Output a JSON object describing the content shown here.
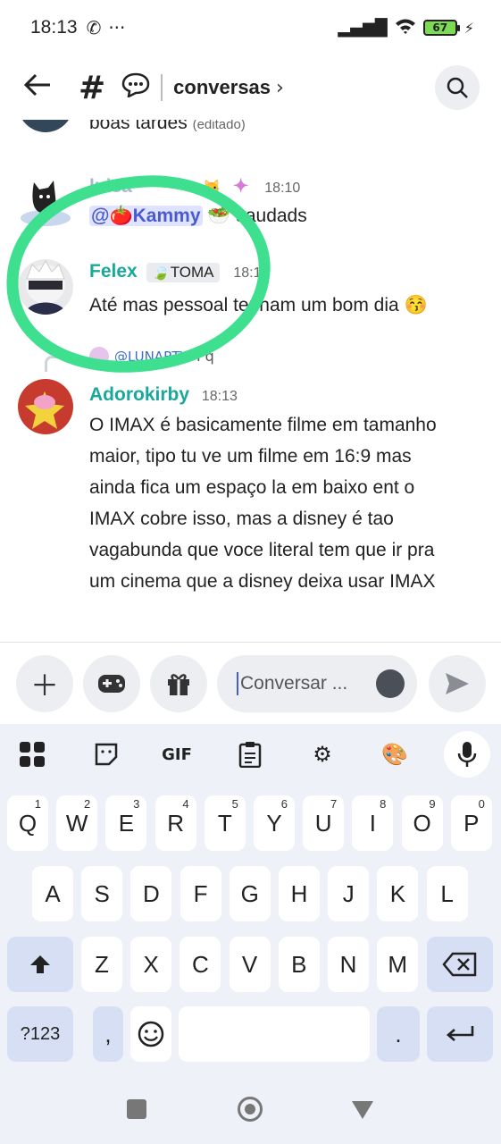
{
  "status": {
    "time": "18:13",
    "icons": [
      "whatsapp-icon",
      "more-icon",
      "signal-icon",
      "wifi-icon"
    ],
    "battery": "67"
  },
  "header": {
    "title": "conversas"
  },
  "messages": [
    {
      "text": "boas tardes",
      "edited": "(editado)"
    },
    {
      "name": "luisa",
      "time": "18:10",
      "mention": "@🍅Kammy",
      "text": "saudads"
    },
    {
      "name": "Felex",
      "tag": "TOMA",
      "time": "18:13",
      "text": "Até mas pessoal tenham um bom dia 😚"
    },
    {
      "reply_to": "@LUNARTY",
      "reply_preview": "Pq"
    },
    {
      "name": "Adorokirby",
      "time": "18:13",
      "lines": [
        "O IMAX é basicamente filme em tamanho",
        "maior, tipo tu ve um filme em 16:9 mas",
        "ainda fica um espaço la em baixo ent o",
        "IMAX cobre isso, mas a disney é tao",
        "vagabunda que voce literal tem que ir pra",
        "um cinema que a disney deixa usar IMAX"
      ]
    }
  ],
  "composer": {
    "placeholder": "Conversar ..."
  },
  "keyboard": {
    "toolbar_gif": "GIF",
    "row1": [
      [
        "Q",
        "1"
      ],
      [
        "W",
        "2"
      ],
      [
        "E",
        "3"
      ],
      [
        "R",
        "4"
      ],
      [
        "T",
        "5"
      ],
      [
        "Y",
        "6"
      ],
      [
        "U",
        "7"
      ],
      [
        "I",
        "8"
      ],
      [
        "O",
        "9"
      ],
      [
        "P",
        "0"
      ]
    ],
    "row2": [
      "A",
      "S",
      "D",
      "F",
      "G",
      "H",
      "J",
      "K",
      "L"
    ],
    "row3": [
      "Z",
      "X",
      "C",
      "V",
      "B",
      "N",
      "M"
    ],
    "symbols": "?123",
    "comma": ",",
    "period": "."
  },
  "colors": {
    "felex": "#1aa89a",
    "adorokirby": "#1aa89a",
    "mention": "#4a5ad1",
    "circle": "#3ee08f"
  }
}
